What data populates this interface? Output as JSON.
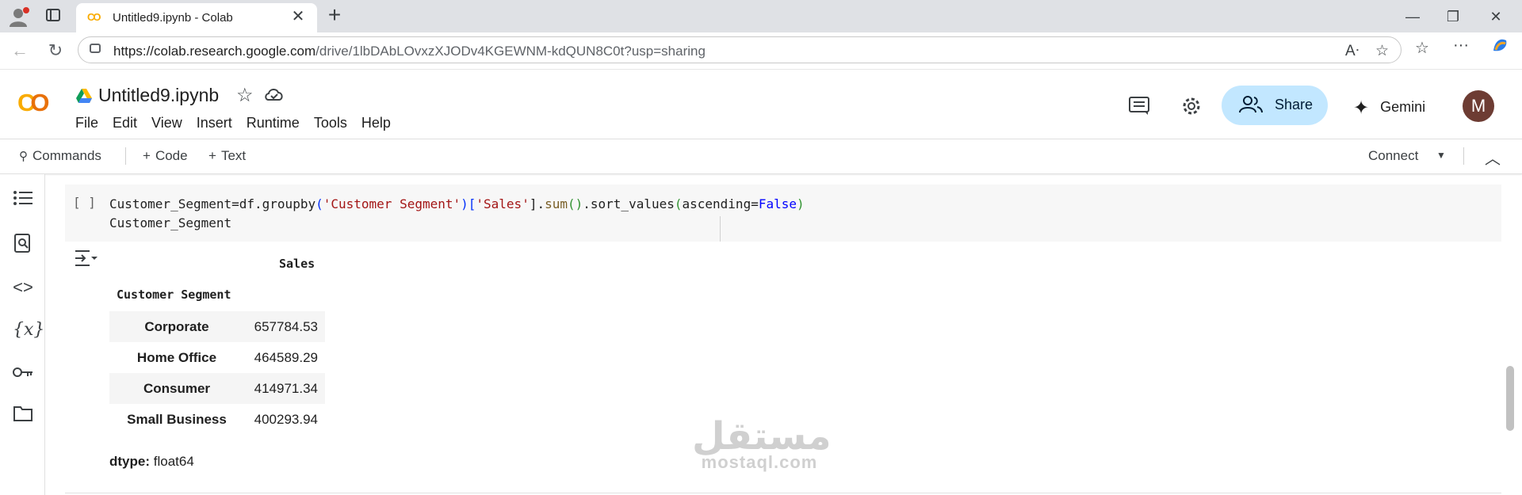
{
  "browser": {
    "tab_title": "Untitled9.ipynb - Colab",
    "tab_favicon": "CO",
    "url_host": "https://colab.research.google.com",
    "url_path": "/drive/1lbDAbLOvxzXJODv4KGEWNM-kdQUN8C0t?usp=sharing"
  },
  "header": {
    "logo_c1": "C",
    "logo_c2": "O",
    "notebook_title": "Untitled9.ipynb",
    "menu": [
      "File",
      "Edit",
      "View",
      "Insert",
      "Runtime",
      "Tools",
      "Help"
    ],
    "share_label": "Share",
    "gemini_label": "Gemini",
    "avatar_initial": "M"
  },
  "toolbar": {
    "commands_label": "Commands",
    "code_label": "Code",
    "text_label": "Text",
    "connect_label": "Connect"
  },
  "cell": {
    "run_marker": "[ ]",
    "line1_a": "Customer_Segment=df.groupby",
    "line1_b": "(",
    "line1_c": "'Customer Segment'",
    "line1_d": ")[",
    "line1_e": "'Sales'",
    "line1_f": "].",
    "line1_g": "sum",
    "line1_h": "()",
    "line1_i": ".sort_values",
    "line1_j": "(",
    "line1_k": "ascending=",
    "line1_l": "False",
    "line1_m": ")",
    "line2": "Customer_Segment"
  },
  "output": {
    "column_header": "Sales",
    "index_header": "Customer Segment",
    "rows": [
      {
        "segment": "Corporate",
        "sales": "657784.53"
      },
      {
        "segment": "Home Office",
        "sales": "464589.29"
      },
      {
        "segment": "Consumer",
        "sales": "414971.34"
      },
      {
        "segment": "Small Business",
        "sales": "400293.94"
      }
    ],
    "dtype_label": "dtype:",
    "dtype_value": "float64"
  },
  "watermark": {
    "arabic": "مستقل",
    "latin": "mostaql.com"
  },
  "colors": {
    "accent": "#c2e7ff",
    "logo_orange": "#e8710a",
    "logo_yellow": "#f9ab00"
  }
}
